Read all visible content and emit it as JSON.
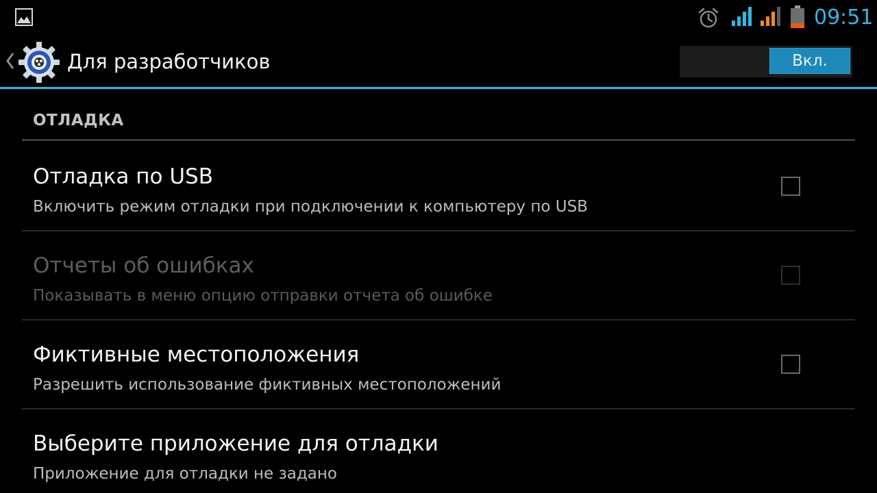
{
  "status_bar": {
    "time": "09:51",
    "icons": [
      "image-notification-icon",
      "alarm-icon",
      "signal-icon",
      "signal-icon",
      "battery-icon"
    ],
    "accent_color": "#33b5e5",
    "signal2_color": "#f08a24",
    "battery_level_color": "#f05a14"
  },
  "action_bar": {
    "title": "Для разработчиков",
    "icon": "settings-gear-icon",
    "switch_label": "Вкл.",
    "switch_on": true
  },
  "section": {
    "header": "ОТЛАДКА"
  },
  "preferences": [
    {
      "title": "Отладка по USB",
      "summary": "Включить режим отладки при подключении к компьютеру по USB",
      "checked": false,
      "enabled": true
    },
    {
      "title": "Отчеты об ошибках",
      "summary": "Показывать в меню опцию отправки отчета об ошибке",
      "checked": false,
      "enabled": false
    },
    {
      "title": "Фиктивные местоположения",
      "summary": "Разрешить использование фиктивных местоположений",
      "checked": false,
      "enabled": true
    },
    {
      "title": "Выберите приложение для отладки",
      "summary": "Приложение для отладки не задано",
      "enabled": true
    }
  ]
}
